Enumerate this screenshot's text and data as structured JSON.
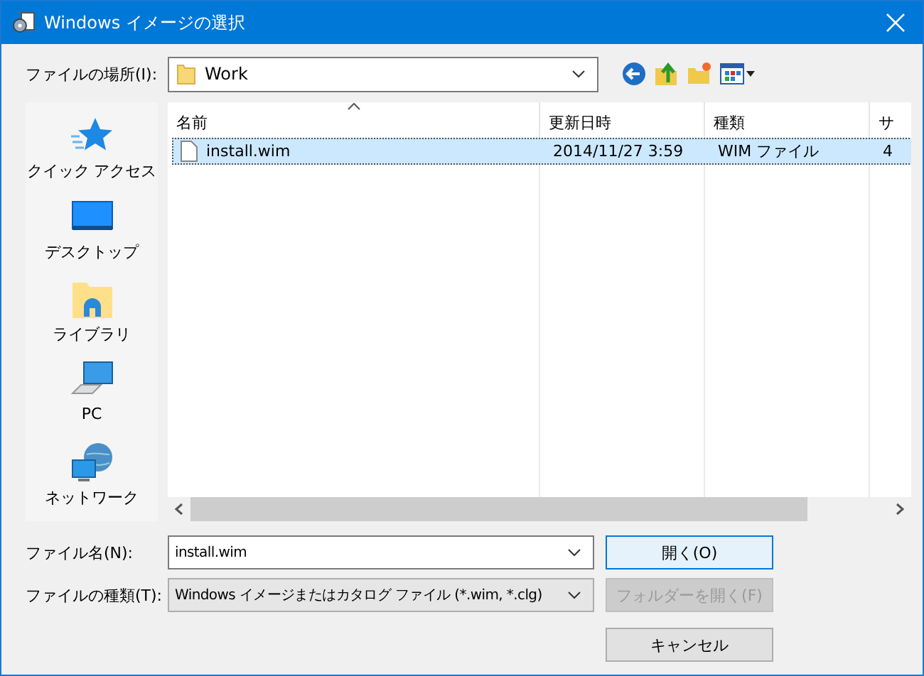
{
  "window": {
    "title": "Windows イメージの選択"
  },
  "location": {
    "label": "ファイルの場所(I):",
    "value": "Work"
  },
  "sidebar": {
    "items": [
      {
        "label": "クイック アクセス",
        "kind": "star"
      },
      {
        "label": "デスクトップ",
        "kind": "desktop"
      },
      {
        "label": "ライブラリ",
        "kind": "library"
      },
      {
        "label": "PC",
        "kind": "pc"
      },
      {
        "label": "ネットワーク",
        "kind": "network"
      }
    ]
  },
  "table": {
    "columns": [
      {
        "label": "名前",
        "sorted": true
      },
      {
        "label": "更新日時",
        "sorted": false
      },
      {
        "label": "種類",
        "sorted": false
      },
      {
        "label": "サ",
        "sorted": false
      }
    ],
    "rows": [
      {
        "cells": [
          "install.wim",
          "2014/11/27 3:59",
          "WIM ファイル",
          "4"
        ],
        "selected": true
      }
    ]
  },
  "filename": {
    "label": "ファイル名(N):",
    "value": "install.wim"
  },
  "filetype": {
    "label": "ファイルの種類(T):",
    "value": "Windows イメージまたはカタログ ファイル (*.wim, *.clg)"
  },
  "buttons": [
    {
      "label": "開く(O)",
      "default": true,
      "disabled": false
    },
    {
      "label": "フォルダーを開く(F)",
      "default": false,
      "disabled": true
    },
    {
      "label": "キャンセル",
      "default": false,
      "disabled": false
    }
  ]
}
